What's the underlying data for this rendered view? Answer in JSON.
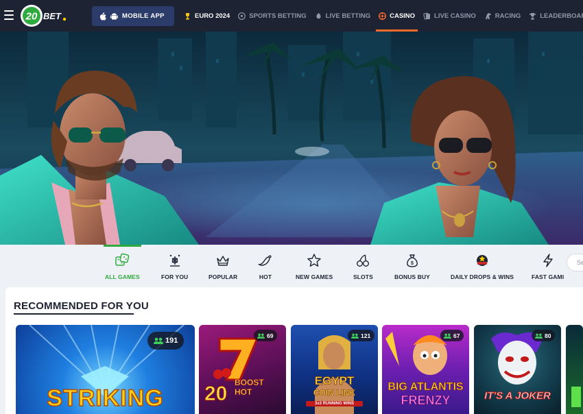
{
  "nav": {
    "logo_text": "20BET",
    "app_button": "MOBILE APP",
    "items": [
      {
        "label": "EURO 2024",
        "icon": "trophy-icon"
      },
      {
        "label": "SPORTS BETTING",
        "icon": "soccer-ball-icon"
      },
      {
        "label": "LIVE BETTING",
        "icon": "live-icon"
      },
      {
        "label": "CASINO",
        "icon": "roulette-icon"
      },
      {
        "label": "LIVE CASINO",
        "icon": "cards-icon"
      },
      {
        "label": "RACING",
        "icon": "horse-icon"
      },
      {
        "label": "LEADERBOARDS",
        "icon": "ranking-icon"
      }
    ],
    "active": "CASINO"
  },
  "categories": [
    {
      "label": "ALL GAMES",
      "icon": "dice-icon"
    },
    {
      "label": "FOR YOU",
      "icon": "sparkle-icon"
    },
    {
      "label": "POPULAR",
      "icon": "crown-icon"
    },
    {
      "label": "HOT",
      "icon": "chili-icon"
    },
    {
      "label": "NEW GAMES",
      "icon": "star-icon"
    },
    {
      "label": "SLOTS",
      "icon": "cherry-icon"
    },
    {
      "label": "BONUS BUY",
      "icon": "money-bag-icon"
    },
    {
      "label": "DAILY DROPS & WINS",
      "icon": "drops-wins-icon"
    },
    {
      "label": "FAST GAMI",
      "icon": "lightning-icon"
    }
  ],
  "active_category": "ALL GAMES",
  "search": {
    "placeholder": "Se"
  },
  "recommended": {
    "title": "RECOMMENDED FOR YOU",
    "games": [
      {
        "title": "STRIKING",
        "players": "191"
      },
      {
        "title_line1": "20",
        "title_line2": "BOOST HOT",
        "players": "69"
      },
      {
        "title_line1": "EGYPT",
        "title_line2": "COIN LINK",
        "subtitle": "3x3 RUNNING WINS",
        "players": "121"
      },
      {
        "title_line1": "BIG ATLANTIS",
        "title_line2": "FRENZY",
        "players": "67"
      },
      {
        "title": "IT'S A JOKER",
        "players": "80"
      }
    ]
  },
  "colors": {
    "nav_bg": "#1d2332",
    "accent_orange": "#ff6a2b",
    "accent_green": "#2faa3f",
    "app_button_bg": "#2c3c6a"
  }
}
